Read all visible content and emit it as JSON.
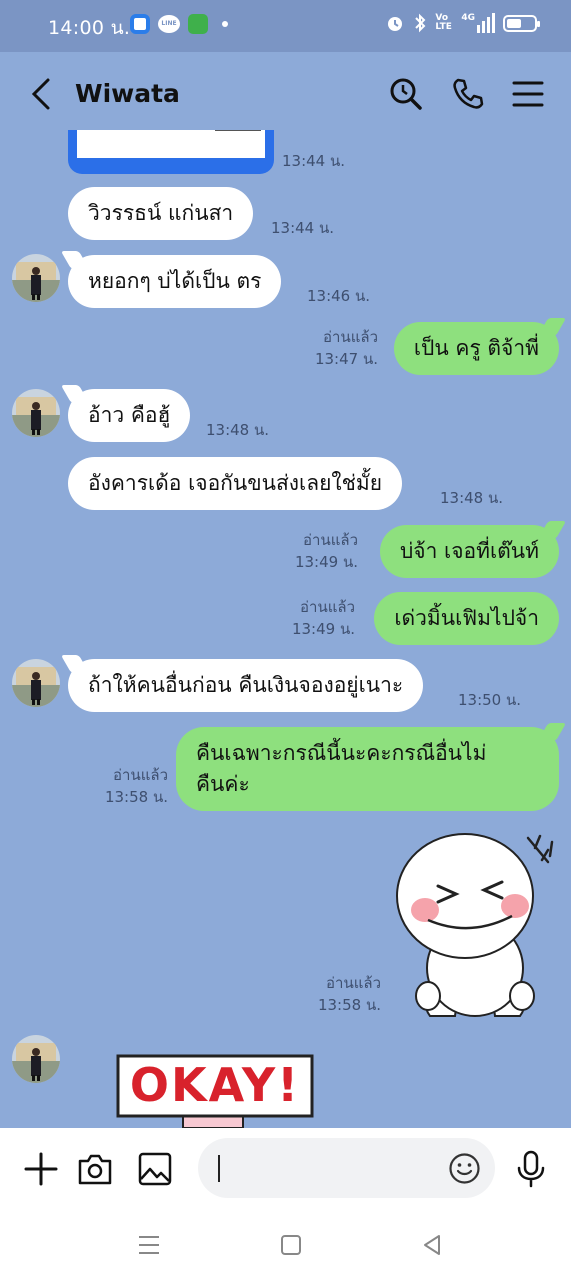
{
  "status_bar": {
    "time": "14:00 น.",
    "app_icons": [
      "blue-app-icon",
      "line-icon",
      "green-chat-icon"
    ],
    "right_icons": [
      "alarm-icon",
      "bluetooth-icon",
      "volte-icon",
      "signal-4g-icon",
      "battery-icon"
    ],
    "volte_label": "Vo LTE",
    "network_label": "4G"
  },
  "header": {
    "contact_name": "Wiwata",
    "actions": [
      "search-icon",
      "phone-icon",
      "menu-icon"
    ]
  },
  "messages": [
    {
      "id": "m0",
      "side": "in",
      "type": "image",
      "time": "13:44 น."
    },
    {
      "id": "m1",
      "side": "in",
      "text": "วิวรรธน์ แก่นสา",
      "time": "13:44 น."
    },
    {
      "id": "m2",
      "side": "in",
      "text": "หยอกๆ บ่ได้เป็น ตร",
      "time": "13:46 น."
    },
    {
      "id": "m3",
      "side": "out",
      "text": "เป็น ครู ติจ้าพี่",
      "read": "อ่านแล้ว",
      "time": "13:47 น."
    },
    {
      "id": "m4",
      "side": "in",
      "text": "อ้าว คือฮู้",
      "time": "13:48 น."
    },
    {
      "id": "m5",
      "side": "in",
      "text": "อังคารเด้อ เจอกันขนส่งเลยใช่มั้ย",
      "time": "13:48 น."
    },
    {
      "id": "m6",
      "side": "out",
      "text": "บ่จ้า เจอที่เต๊นท์",
      "read": "อ่านแล้ว",
      "time": "13:49 น."
    },
    {
      "id": "m7",
      "side": "out",
      "text": "เด่วมิ้นเฟิมไปจ้า",
      "read": "อ่านแล้ว",
      "time": "13:49 น."
    },
    {
      "id": "m8",
      "side": "in",
      "text": "ถ้าให้คนอื่นก่อน คืนเงินจองอยู่เนาะ",
      "time": "13:50 น."
    },
    {
      "id": "m9",
      "side": "out",
      "text_line1": "คืนเฉพาะกรณีนี้นะคะกรณีอื่นไม่",
      "text_line2": "คืนค่ะ",
      "read": "อ่านแล้ว",
      "time": "13:58 น."
    },
    {
      "id": "m10",
      "side": "out",
      "type": "sticker",
      "sticker": "laughing-bear-sticker",
      "read": "อ่านแล้ว",
      "time": "13:58 น."
    },
    {
      "id": "m11",
      "side": "in",
      "type": "sticker",
      "sticker": "okay-sign-sticker",
      "sticker_text": "OKAY!"
    }
  ],
  "input": {
    "placeholder": "",
    "left_actions": [
      "plus-icon",
      "camera-icon",
      "gallery-icon"
    ],
    "right_actions": [
      "emoji-icon",
      "microphone-icon"
    ]
  },
  "nav": [
    "recent-apps-icon",
    "home-icon",
    "back-icon"
  ],
  "colors": {
    "chat_bg": "#8daad8",
    "status_bg": "#7b95c4",
    "incoming_bubble": "#ffffff",
    "outgoing_bubble": "#8ee07e"
  }
}
